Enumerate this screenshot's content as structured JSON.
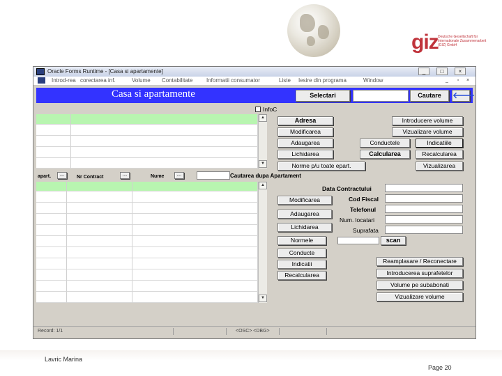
{
  "slide": {
    "author": "Lavric Marina",
    "page": "Page 20",
    "logo_text": "giz",
    "logo_subtext": "Deutsche Gesellschaft für Internationale Zusammenarbeit (GIZ) GmbH"
  },
  "window": {
    "title": "Oracle Forms Runtime - [Casa si apartamente]",
    "controls": {
      "minimize": "_",
      "maximize": "□",
      "close": "×"
    },
    "menu": [
      "Introd-rea",
      "corectarea inf.",
      "Volume",
      "Contabilitate",
      "Informatii consumator",
      "Liste",
      "Iesire din programa",
      "Window"
    ],
    "menu_controls": {
      "minimize": "_",
      "restore": "▫",
      "close": "×"
    }
  },
  "form": {
    "title": "Casa si apartamente",
    "selectari": "Selectari",
    "cautare": "Cautare",
    "back_arrow": "🡐",
    "infoc_label": "InfoC",
    "top_buttons": {
      "adresa": "Adresa",
      "modificarea": "Modificarea",
      "adaugarea": "Adaugarea",
      "lichidarea": "Lichidarea",
      "norme": "Norme p/u toate epart.",
      "introducere_volume": "Introducere volume",
      "vizualizare_volume": "Vizualizare volume",
      "conductele": "Conductele",
      "indicatiile": "Indicatiile",
      "calcularea": "Calcularea",
      "recalcularea": "Recalcularea",
      "vizualizarea": "Vizualizarea"
    },
    "apart_header": {
      "apart": "apart.",
      "nr_contract": "Nr Contract",
      "nume": "Nume",
      "lov": "....",
      "search_caption": "Cautarea dupa Apartament"
    },
    "apart_labels": {
      "data_contract": "Data Contractului",
      "cod_fiscal": "Cod Fiscal",
      "telefonul": "Telefonul",
      "num_locatari": "Num. locatari",
      "suprafata": "Suprafata"
    },
    "apart_buttons": {
      "modificarea": "Modificarea",
      "adaugarea": "Adaugarea",
      "lichidarea": "Lichidarea",
      "normele": "Normele",
      "conducte": "Conducte",
      "indicatii": "Indicatii",
      "recalcularea": "Recalcularea",
      "scan": "scan",
      "reamplasare": "Reamplasare / Reconectare",
      "introducerea_suprafetelor": "Introducerea suprafetelor",
      "volume_subabonati": "Volume pe subabonati",
      "vizualizare_volume": "Vizualizare volume"
    },
    "status": {
      "record": "Record: 1/1",
      "mode": "<OSC> <DBG>"
    }
  }
}
